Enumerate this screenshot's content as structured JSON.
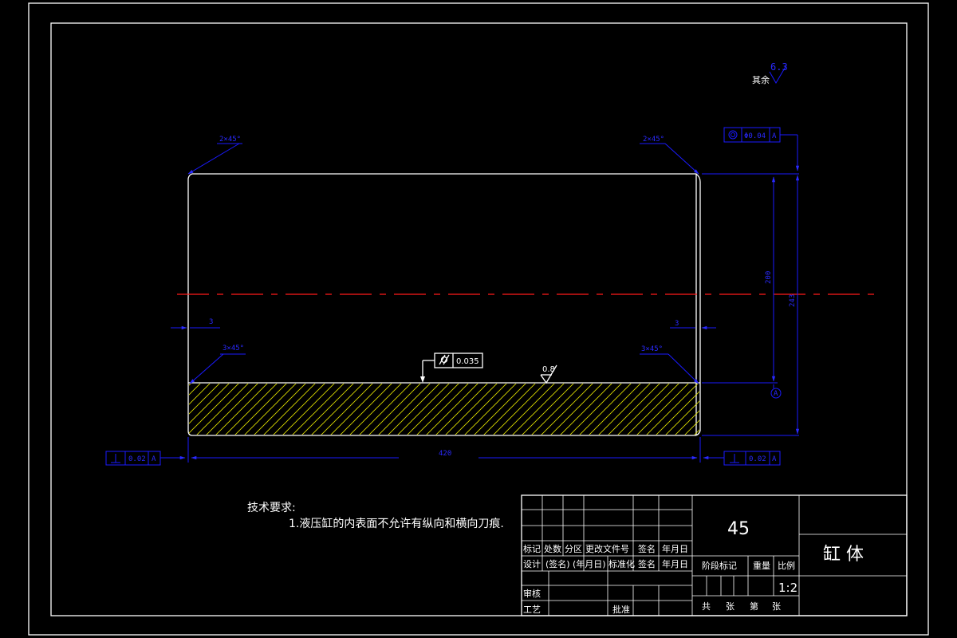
{
  "surface_finish": {
    "label": "其余",
    "value": "6.3",
    "inner_value": "0.8"
  },
  "chamfers": {
    "top_left": "2×45°",
    "top_right": "2×45°",
    "bottom_left": "3×45°",
    "bottom_right": "3×45°"
  },
  "dimensions": {
    "length": "420",
    "inner_height": "200",
    "outer_height": "243",
    "left_offset": "3",
    "right_offset": "3"
  },
  "tolerances": {
    "coaxiality": {
      "value": "Φ0.04",
      "datum": "A"
    },
    "cylindricity": {
      "value": "0.035"
    },
    "perp_left": {
      "value": "0.02",
      "datum": "A"
    },
    "perp_right": {
      "value": "0.02",
      "datum": "A"
    }
  },
  "datum_label": "A",
  "notes": {
    "title": "技术要求:",
    "item1": "1.液压缸的内表面不允许有纵向和横向刀痕."
  },
  "title_block": {
    "material": "45",
    "part_name": "缸 体",
    "scale": "1:2",
    "head_row": [
      "标记",
      "处数",
      "分区",
      "更改文件号",
      "签名",
      "年月日"
    ],
    "design_row": [
      "设计",
      "(签名)",
      "(年月日)",
      "标准化",
      "签名",
      "年月日"
    ],
    "review": "审核",
    "process": "工艺",
    "approve": "批准",
    "stage_mark": "阶段标记",
    "weight": "重量",
    "ratio": "比例",
    "sheets_total": "共",
    "sheets_unit1": "张",
    "sheets_no": "第",
    "sheets_unit2": "张"
  }
}
